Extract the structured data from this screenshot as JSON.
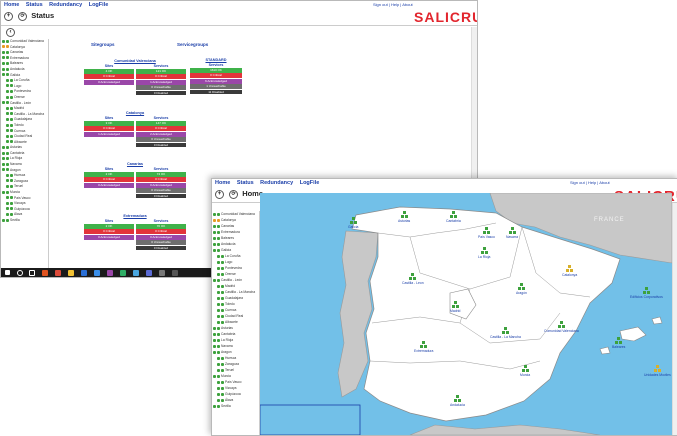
{
  "window1": {
    "menu": [
      "Home",
      "Status",
      "Redundancy",
      "LogFile"
    ],
    "topright": "Sign out | Help | About",
    "logo": "SALICRU",
    "title": "Status",
    "sites_group_header": "Sitegroups",
    "service_group_header": "Servicegroups",
    "sidebar": [
      {
        "label": "Comunidad Valenciana",
        "color": "green"
      },
      {
        "label": "Catalonya",
        "color": "orange"
      },
      {
        "label": "Canarias",
        "color": "green"
      },
      {
        "label": "Extremadura",
        "color": "green"
      },
      {
        "label": "Baleares",
        "color": "green"
      },
      {
        "label": "Andalucia",
        "color": "green"
      },
      {
        "label": "Galicia",
        "color": "green"
      },
      {
        "label": "La Coruña",
        "color": "green"
      },
      {
        "label": "Lugo",
        "color": "green"
      },
      {
        "label": "Pontevedra",
        "color": "green"
      },
      {
        "label": "Orense",
        "color": "green"
      },
      {
        "label": "Castilla - León",
        "color": "green"
      },
      {
        "label": "Madrid",
        "color": "green"
      },
      {
        "label": "Castilla - La Mancha",
        "color": "green"
      },
      {
        "label": "Guadalajara",
        "color": "green"
      },
      {
        "label": "Toledo",
        "color": "green"
      },
      {
        "label": "Cuenca",
        "color": "green"
      },
      {
        "label": "Ciudad Real",
        "color": "green"
      },
      {
        "label": "Albacete",
        "color": "green"
      },
      {
        "label": "Asturias",
        "color": "green"
      },
      {
        "label": "Cantabria",
        "color": "green"
      },
      {
        "label": "La Rioja",
        "color": "green"
      },
      {
        "label": "Navarra",
        "color": "green"
      },
      {
        "label": "Aragon",
        "color": "green"
      },
      {
        "label": "Huesca",
        "color": "green"
      },
      {
        "label": "Zaragoza",
        "color": "green"
      },
      {
        "label": "Teruel",
        "color": "green"
      },
      {
        "label": "Murcia",
        "color": "green"
      },
      {
        "label": "País Vasco",
        "color": "green"
      },
      {
        "label": "Vizcaya",
        "color": "green"
      },
      {
        "label": "Guipúzcoa",
        "color": "green"
      },
      {
        "label": "Álava",
        "color": "green"
      },
      {
        "label": "Sevilla",
        "color": "green"
      }
    ],
    "groups": [
      {
        "title": "Comunidad Valenciana",
        "sites_label": "Sites",
        "services_label": "Services",
        "rows": [
          {
            "sites": "4 OK",
            "sites_class": "ok",
            "services": "121 OK",
            "services_class": "ok"
          },
          {
            "sites": "0 Critical",
            "sites_class": "cr",
            "services": "0 Critical",
            "services_class": "cr"
          },
          {
            "sites": "0 Acknowledged",
            "sites_class": "ac",
            "services": "1 Acknowledged",
            "services_class": "ac"
          },
          {
            "sites": "",
            "sites_class": "blank",
            "services": "0 Unreachable",
            "services_class": "un"
          },
          {
            "sites": "",
            "sites_class": "blank",
            "services": "0 Disabled",
            "services_class": "di"
          }
        ]
      },
      {
        "title": "Catalonya",
        "sites_label": "Sites",
        "services_label": "Services",
        "rows": [
          {
            "sites": "3 OK",
            "sites_class": "ok",
            "services": "147 OK",
            "services_class": "ok"
          },
          {
            "sites": "0 Critical",
            "sites_class": "cr",
            "services": "0 Critical",
            "services_class": "cr"
          },
          {
            "sites": "1 Acknowledged",
            "sites_class": "ac",
            "services": "2 Acknowledged",
            "services_class": "ac"
          },
          {
            "sites": "",
            "sites_class": "blank",
            "services": "0 Unreachable",
            "services_class": "un"
          },
          {
            "sites": "",
            "sites_class": "blank",
            "services": "0 Disabled",
            "services_class": "di"
          }
        ]
      },
      {
        "title": "Canarias",
        "sites_label": "Sites",
        "services_label": "Services",
        "rows": [
          {
            "sites": "2 OK",
            "sites_class": "ok",
            "services": "74 OK",
            "services_class": "ok"
          },
          {
            "sites": "0 Critical",
            "sites_class": "cr",
            "services": "0 Critical",
            "services_class": "cr"
          },
          {
            "sites": "0 Acknowledged",
            "sites_class": "ac",
            "services": "0 Acknowledged",
            "services_class": "ac"
          },
          {
            "sites": "",
            "sites_class": "blank",
            "services": "0 Unreachable",
            "services_class": "un"
          },
          {
            "sites": "",
            "sites_class": "blank",
            "services": "0 Disabled",
            "services_class": "di"
          }
        ]
      },
      {
        "title": "Extremadura",
        "sites_label": "Sites",
        "services_label": "Services",
        "rows": [
          {
            "sites": "2 OK",
            "sites_class": "ok",
            "services": "70 OK",
            "services_class": "ok"
          },
          {
            "sites": "0 Critical",
            "sites_class": "cr",
            "services": "0 Critical",
            "services_class": "cr"
          },
          {
            "sites": "0 Acknowledged",
            "sites_class": "ac",
            "services": "0 Acknowledged",
            "services_class": "ac"
          },
          {
            "sites": "",
            "sites_class": "blank",
            "services": "0 Unreachable",
            "services_class": "un"
          },
          {
            "sites": "",
            "sites_class": "blank",
            "services": "0 Disabled",
            "services_class": "di"
          }
        ]
      }
    ],
    "service_group": {
      "title": "STANDARD",
      "services_label": "Services",
      "rows": [
        {
          "text": "1610 OK",
          "class": "ok"
        },
        {
          "text": "0 Critical",
          "class": "cr"
        },
        {
          "text": "6 Acknowledged",
          "class": "ac"
        },
        {
          "text": "1 Unreachable",
          "class": "un"
        },
        {
          "text": "11 Disabled",
          "class": "di"
        }
      ]
    }
  },
  "window2": {
    "menu": [
      "Home",
      "Status",
      "Redundancy",
      "LogFile"
    ],
    "topright": "Sign out | Help | About",
    "logo": "SALICRU",
    "title": "Home",
    "country_label": "FRANCE",
    "regions": [
      {
        "name": "Galicia",
        "status": "green"
      },
      {
        "name": "Asturias",
        "status": "green"
      },
      {
        "name": "Cantabria",
        "status": "green"
      },
      {
        "name": "País Vasco",
        "status": "green"
      },
      {
        "name": "Navarra",
        "status": "green"
      },
      {
        "name": "La Rioja",
        "status": "green"
      },
      {
        "name": "Aragón",
        "status": "green"
      },
      {
        "name": "Catalonya",
        "status": "yellow"
      },
      {
        "name": "Castilla - Leon",
        "status": "green"
      },
      {
        "name": "Madrid",
        "status": "green"
      },
      {
        "name": "Extremadura",
        "status": "green"
      },
      {
        "name": "Castilla - La Mancha",
        "status": "green"
      },
      {
        "name": "Comunidad Valenciana",
        "status": "green"
      },
      {
        "name": "Murcia",
        "status": "green"
      },
      {
        "name": "Andalucia",
        "status": "green"
      },
      {
        "name": "Baleares",
        "status": "green"
      },
      {
        "name": "Edificios Corporativos",
        "status": "green"
      },
      {
        "name": "Unidades Moviles",
        "status": "yellow"
      }
    ],
    "colors": {
      "accent": "#1a3ea8",
      "brand": "#e2252d",
      "ok": "#3fb24a",
      "sea": "#72c0e8",
      "land": "#ffffff",
      "foreign_land": "#c8c8c8"
    }
  }
}
